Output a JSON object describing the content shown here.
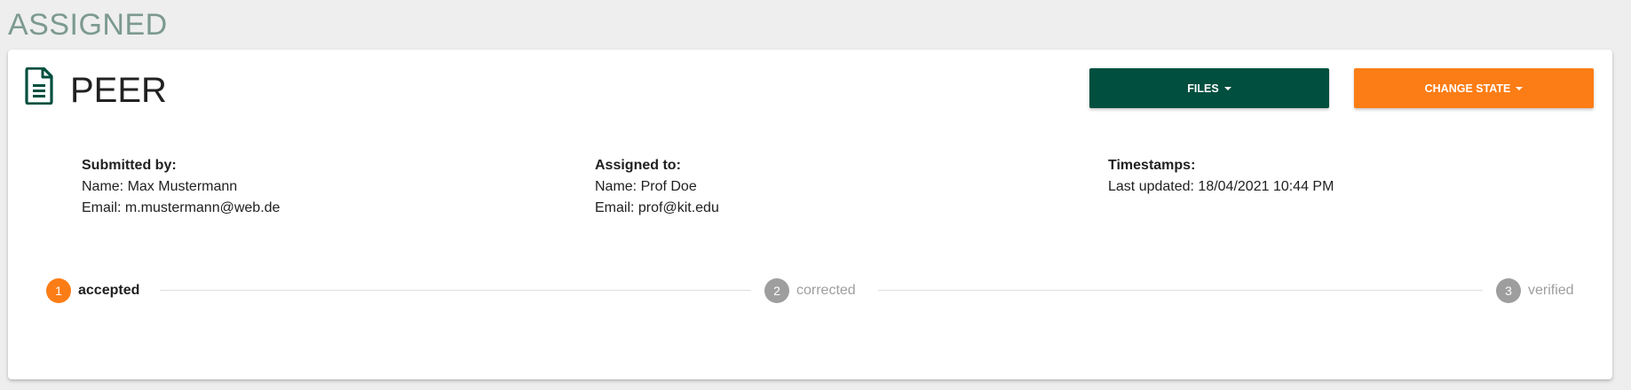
{
  "page": {
    "heading": "ASSIGNED"
  },
  "card": {
    "title": "PEER",
    "icon": "document-icon",
    "buttons": {
      "files_label": "FILES",
      "change_state_label": "CHANGE STATE"
    },
    "submitted_by": {
      "heading": "Submitted by:",
      "name": "Name: Max Mustermann",
      "email": "Email: m.mustermann@web.de"
    },
    "assigned_to": {
      "heading": "Assigned to:",
      "name": "Name: Prof Doe",
      "email": "Email: prof@kit.edu"
    },
    "timestamps": {
      "heading": "Timestamps:",
      "last_updated": "Last updated: 18/04/2021 10:44 PM"
    },
    "steps": [
      {
        "number": "1",
        "label": "accepted",
        "active": true
      },
      {
        "number": "2",
        "label": "corrected",
        "active": false
      },
      {
        "number": "3",
        "label": "verified",
        "active": false
      }
    ]
  },
  "colors": {
    "background": "#eeeeee",
    "heading": "#7d9a8f",
    "primary_dark_green": "#004f3f",
    "accent_orange": "#fc7d15",
    "inactive_grey": "#9e9e9e"
  }
}
